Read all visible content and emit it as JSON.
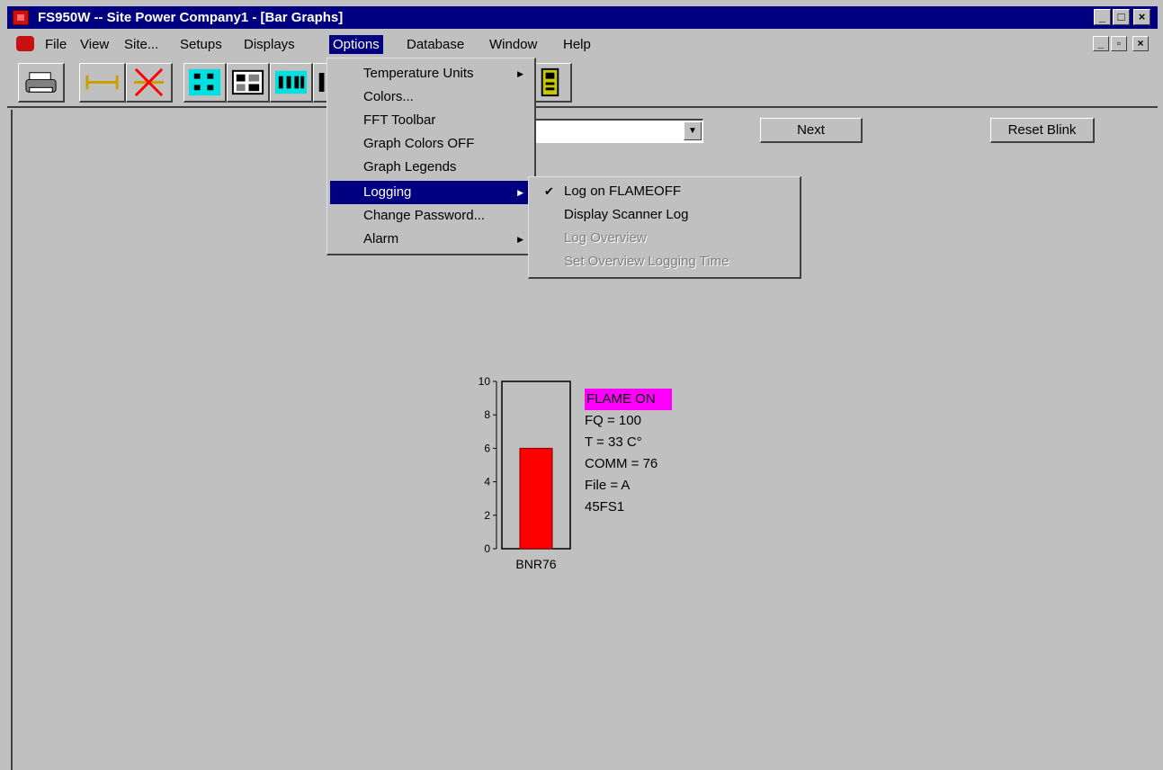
{
  "window": {
    "title": "FS950W -- Site Power Company1 - [Bar Graphs]",
    "controls": [
      "_",
      "□",
      "×"
    ]
  },
  "menubar": {
    "items": [
      "File",
      "View",
      "Site...",
      "Setups",
      "Displays",
      "Options",
      "Database",
      "Window",
      "Help"
    ],
    "active": "Options",
    "mdi_controls": [
      "_",
      "▫",
      "×"
    ]
  },
  "toolbar": {
    "buttons": [
      "print-icon",
      "connect-icon",
      "disconnect-icon",
      "list-view-icon",
      "grid-view-icon",
      "abc-text-icon",
      "bar-graph-icon",
      "log-file-icon"
    ]
  },
  "controls": {
    "next_label": "Next",
    "reset_blink_label": "Reset Blink",
    "combo_value": "",
    "combo_arrow": "▼"
  },
  "options_menu": {
    "items": [
      {
        "label": "Temperature Units",
        "submenu": true
      },
      {
        "label": "Colors...",
        "submenu": false
      },
      {
        "label": "FFT Toolbar",
        "submenu": false
      },
      {
        "label": "Graph Colors OFF",
        "submenu": false
      },
      {
        "label": "Graph Legends",
        "submenu": false
      },
      {
        "label": "Logging",
        "submenu": true,
        "highlighted": true
      },
      {
        "label": "Change Password...",
        "submenu": false
      },
      {
        "label": "Alarm",
        "submenu": true
      }
    ],
    "arrow": "▶"
  },
  "logging_submenu": {
    "items": [
      {
        "label": "Log on FLAMEOFF",
        "checked": true,
        "disabled": false
      },
      {
        "label": "Display Scanner Log",
        "checked": false,
        "disabled": false
      },
      {
        "label": "Log Overview",
        "checked": false,
        "disabled": true
      },
      {
        "label": "Set Overview Logging Time",
        "checked": false,
        "disabled": true
      }
    ],
    "check_mark": "✔"
  },
  "chart_data": {
    "type": "bar",
    "categories": [
      "BNR76"
    ],
    "values": [
      6
    ],
    "ylim": [
      0,
      10
    ],
    "yticks": [
      "0",
      "2",
      "4",
      "6",
      "8",
      "10"
    ],
    "bar_color": "#ff0000"
  },
  "scanner_status": {
    "flame": "FLAME ON",
    "fq": "FQ = 100",
    "temp": "T = 33 C°",
    "comm": "COMM = 76",
    "file": "File = A",
    "model": "45FS1",
    "flame_color": "#ff00ff"
  },
  "colors": {
    "titlebar": "#000080",
    "face": "#c0c0c0",
    "highlight": "#000080"
  }
}
